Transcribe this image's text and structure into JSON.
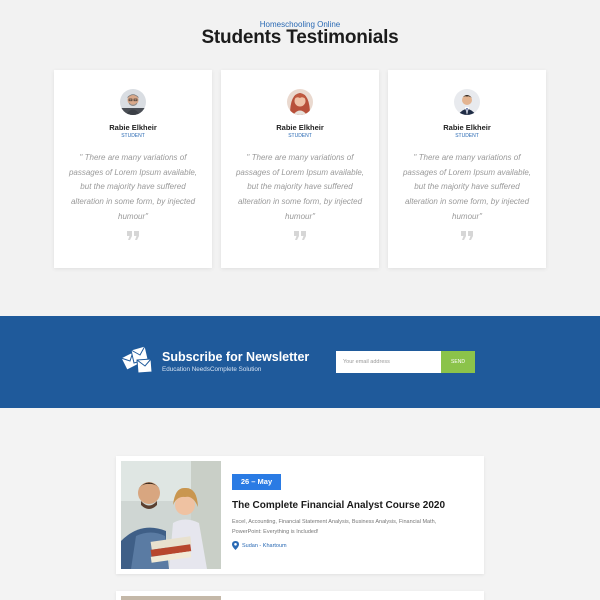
{
  "testimonials": {
    "eyebrow": "Homeschooling Online",
    "title": "Students Testimonials",
    "cards": [
      {
        "name": "Rabie Elkheir",
        "role": "STUDENT",
        "quote": "\" There are many variations of passages of Lorem Ipsum available, but the majority have suffered alteration in some form, by injected humour\"",
        "avatar_icon": "man-avatar-icon"
      },
      {
        "name": "Rabie Elkheir",
        "role": "STUDENT",
        "quote": "\" There are many variations of passages of Lorem Ipsum available, but the majority have suffered alteration in some form, by injected humour\"",
        "avatar_icon": "woman-avatar-icon"
      },
      {
        "name": "Rabie Elkheir",
        "role": "STUDENT",
        "quote": "\" There are many variations of passages of Lorem Ipsum available, but the majority have suffered alteration in some form, by injected humour\"",
        "avatar_icon": "man-suit-avatar-icon"
      }
    ]
  },
  "newsletter": {
    "title": "Subscribe for Newsletter",
    "subtitle": "Education NeedsComplete Solution",
    "email_placeholder": "Your email address",
    "button_label": "SEND",
    "background_color": "#1f5a9b",
    "button_color": "#8bc34a"
  },
  "courses": [
    {
      "date": "26 – May",
      "title": "The Complete Financial Analyst Course 2020",
      "tags": "Excel, Accounting, Financial Statement Analysis, Business Analysis, Financial Math, PowerPoint: Everything is Included!",
      "location": "Sudan - Khartoum"
    }
  ],
  "colors": {
    "accent_blue": "#2a7be4",
    "link_blue": "#2a6ab4"
  }
}
